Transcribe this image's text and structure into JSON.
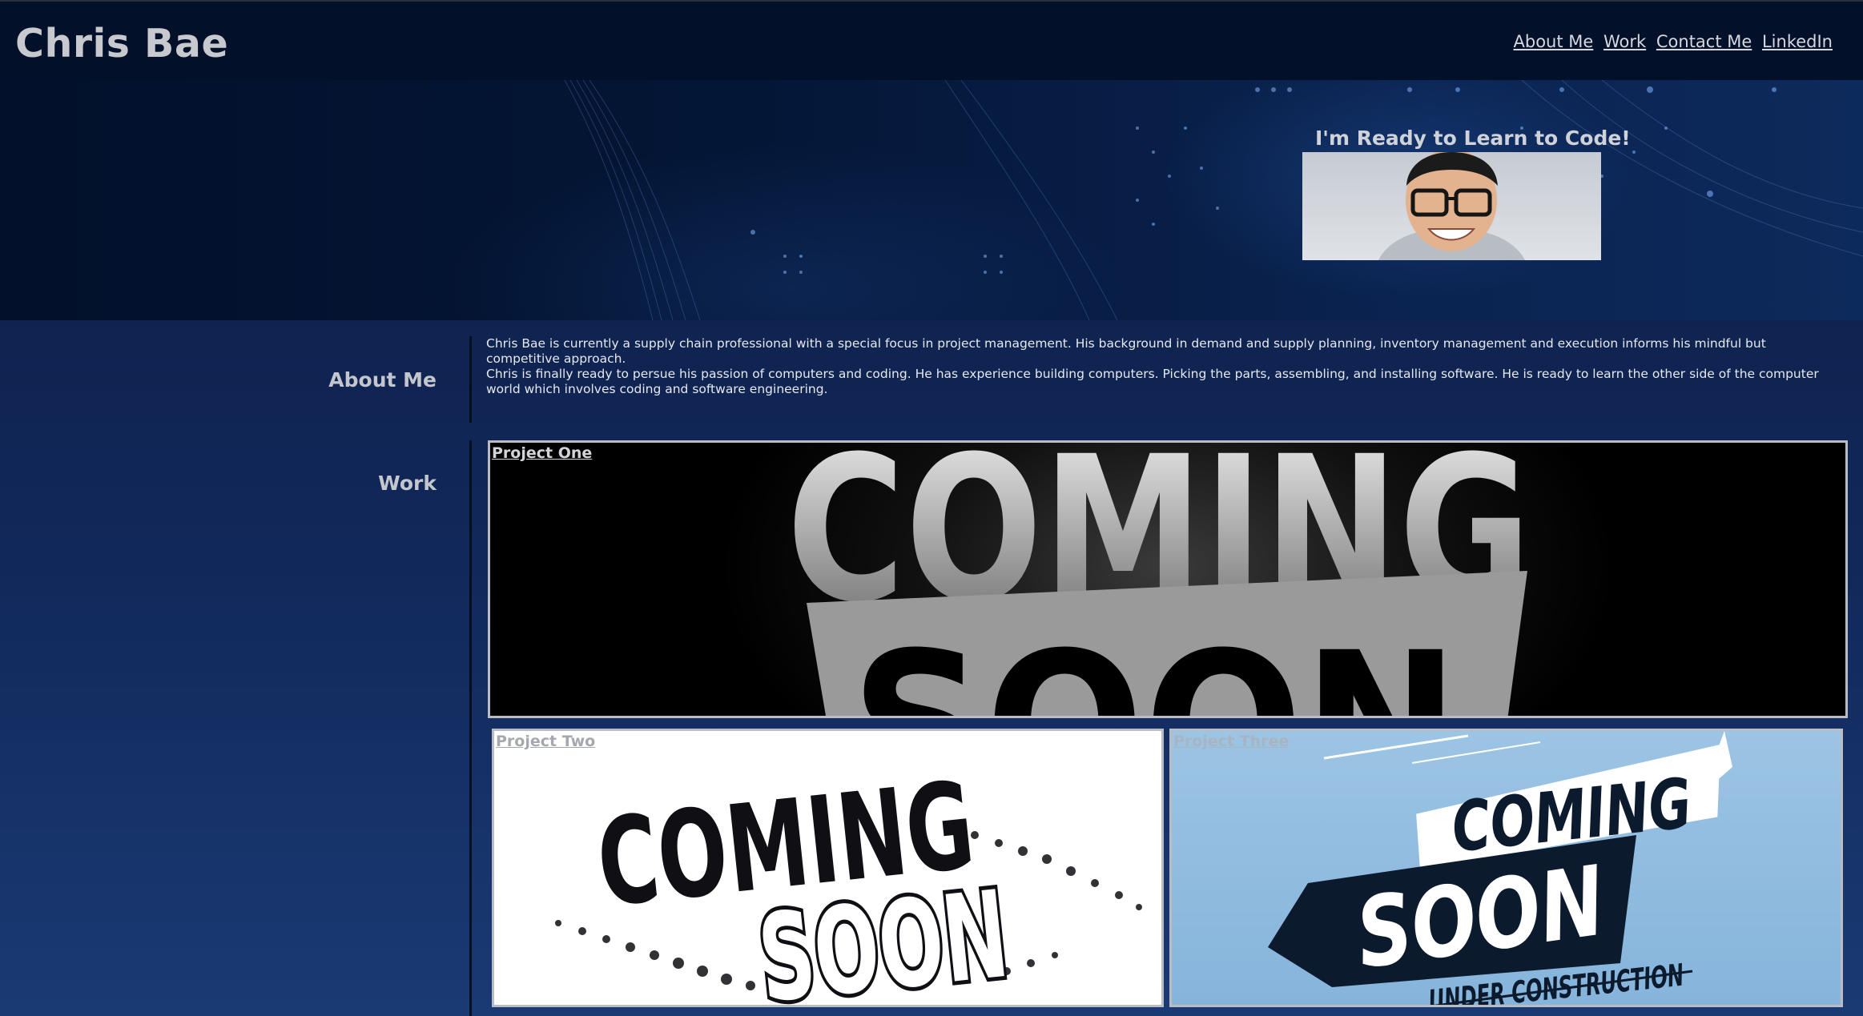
{
  "header": {
    "title": "Chris Bae",
    "nav": [
      "About Me",
      "Work",
      "Contact Me",
      "LinkedIn"
    ]
  },
  "hero": {
    "caption": "I'm Ready to Learn to Code!"
  },
  "about": {
    "heading": "About Me",
    "paragraphs": [
      "Chris Bae is currently a supply chain professional with a special focus in project management. His background in demand and supply planning, inventory management and execution informs his mindful but competitive approach.",
      "Chris is finally ready to persue his passion of computers and coding. He has experience building computers. Picking the parts, assembling, and installing software. He is ready to learn the other side of the computer world which involves coding and software engineering."
    ]
  },
  "work": {
    "heading": "Work",
    "projects": [
      {
        "label": "Project One",
        "image_text": [
          "COMING",
          "SOON"
        ]
      },
      {
        "label": "Project Two",
        "image_text": [
          "COMING",
          "SOON"
        ]
      },
      {
        "label": "Project Three",
        "image_text": [
          "COMING",
          "SOON",
          "UNDER CONSTRUCTION"
        ]
      }
    ]
  },
  "colors": {
    "header_bg": "#03102a",
    "page_bg": "#11285a",
    "accent_text": "#c7c9cf"
  }
}
